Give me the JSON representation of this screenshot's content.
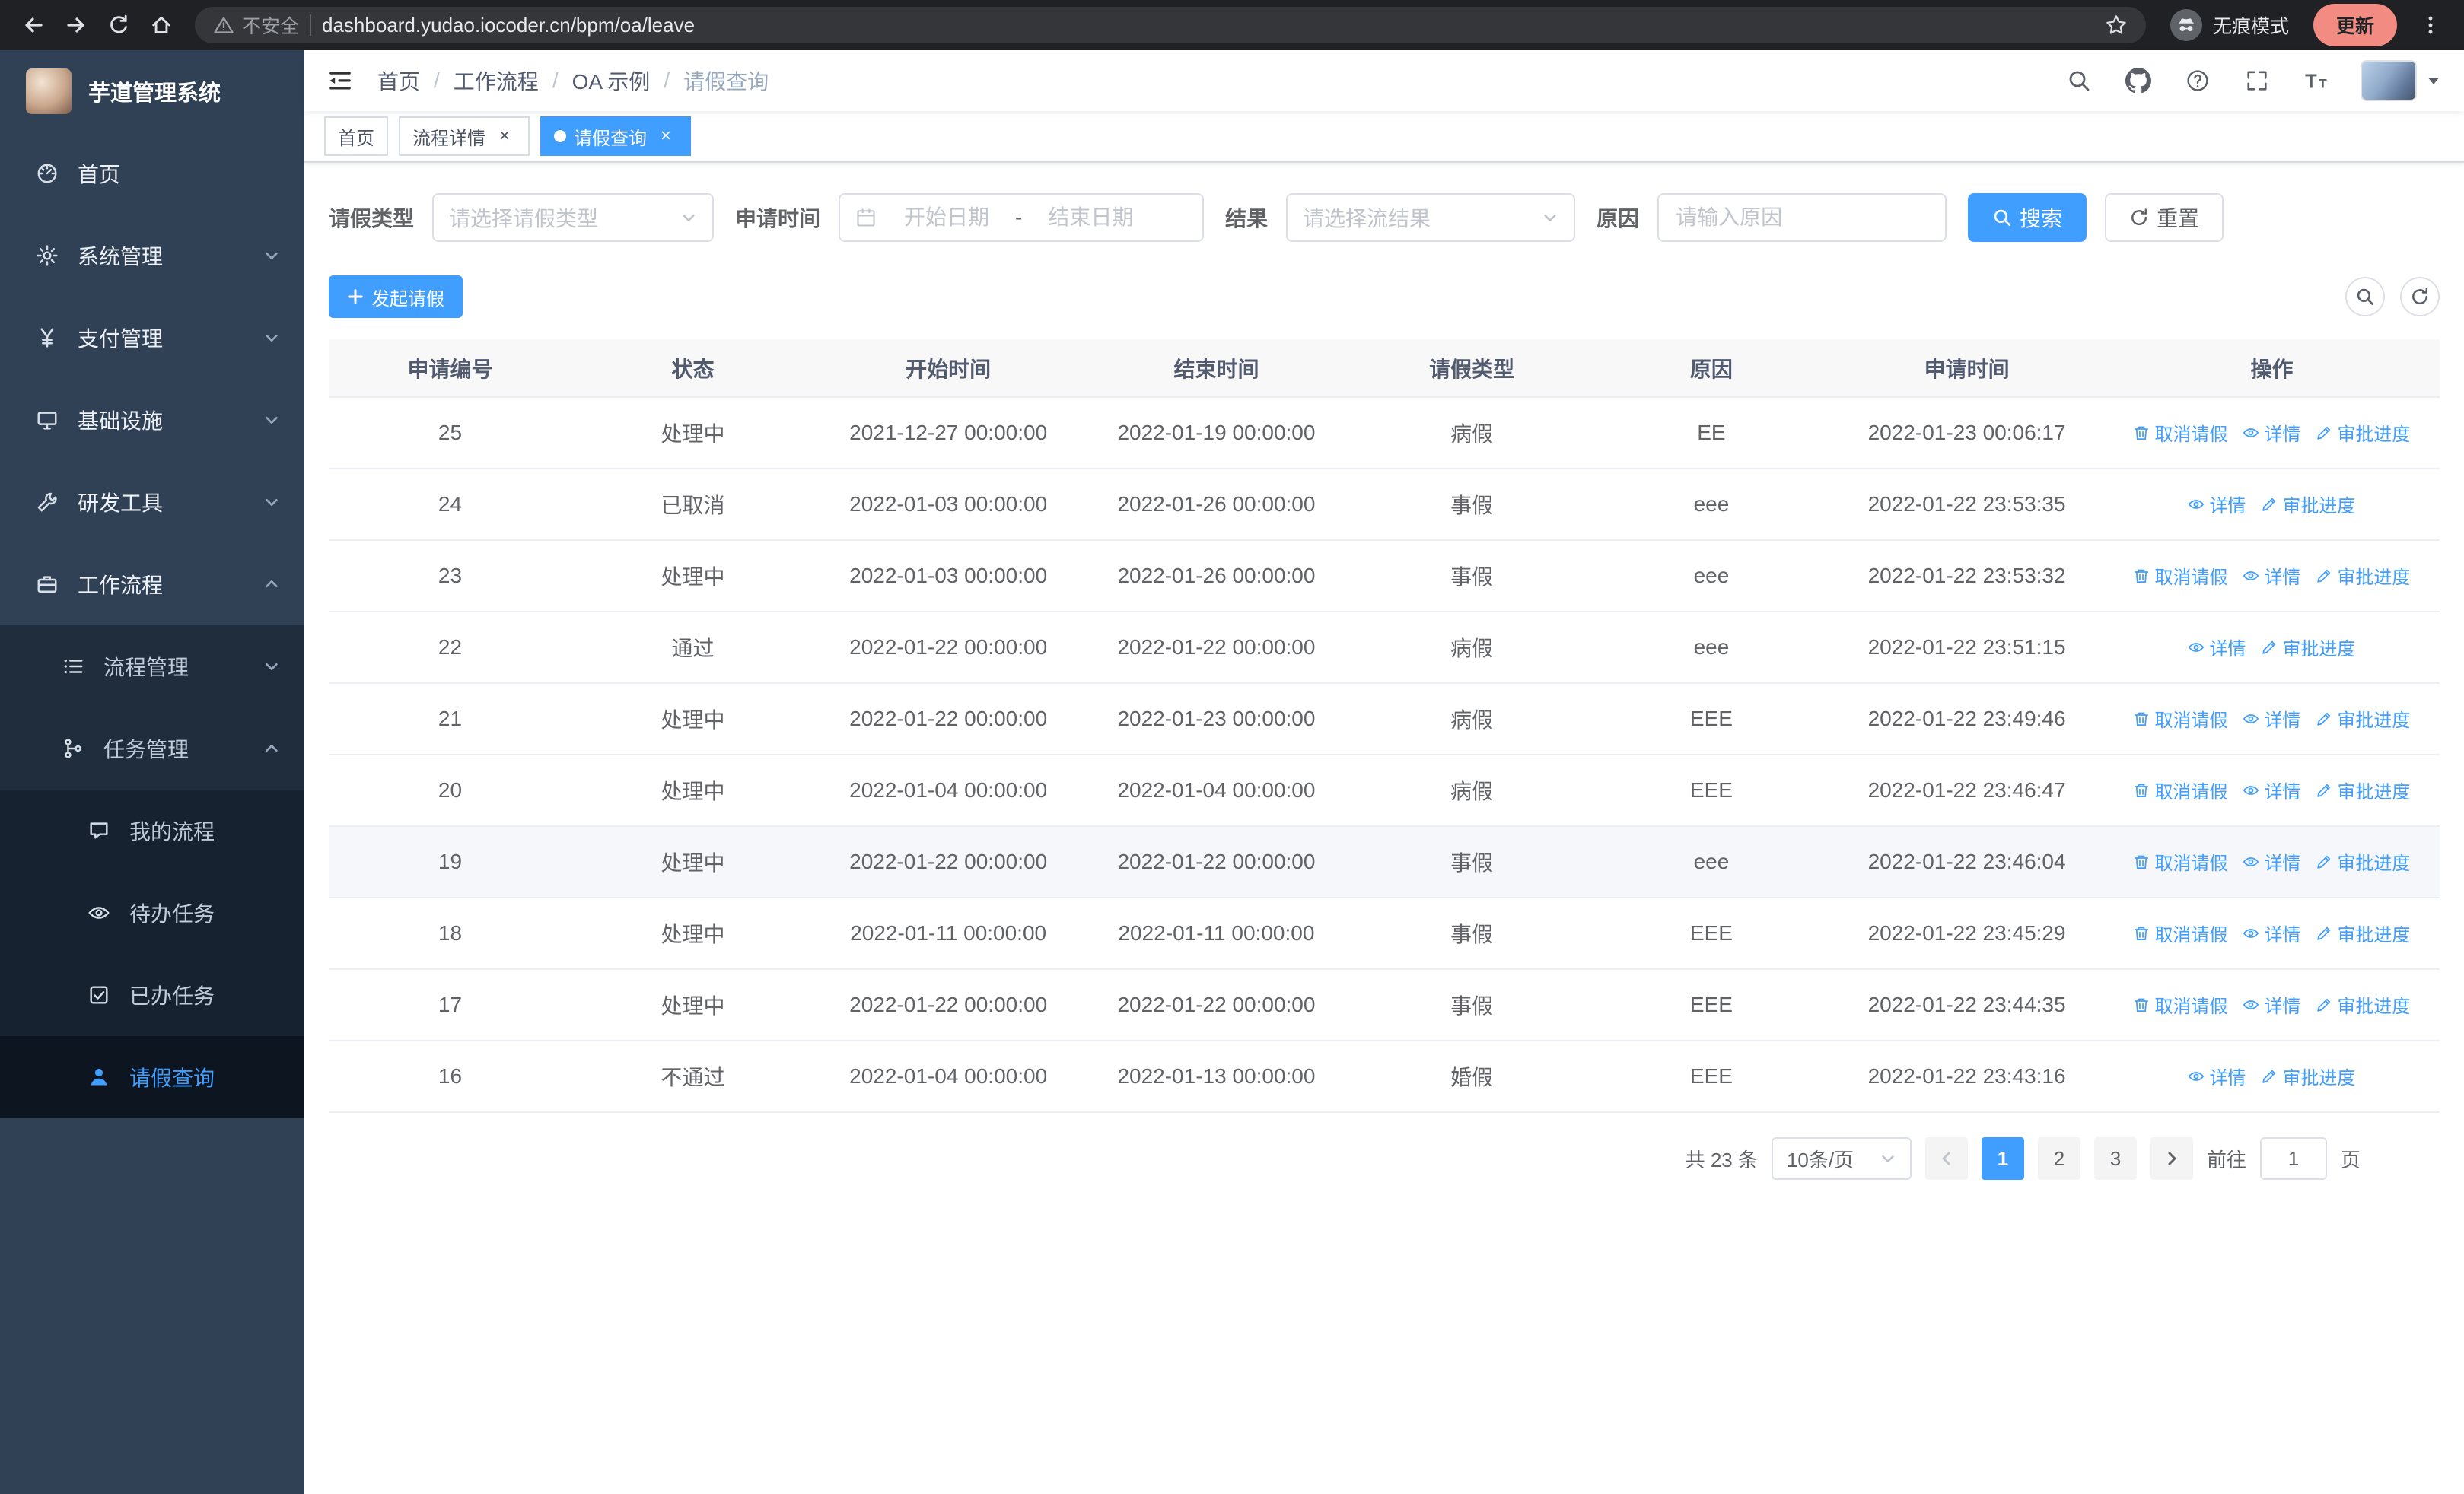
{
  "browser": {
    "security_chip": "不安全",
    "url": "dashboard.yudao.iocoder.cn/bpm/oa/leave",
    "incognito_label": "无痕模式",
    "update_label": "更新"
  },
  "sidebar": {
    "title": "芋道管理系统",
    "items": [
      {
        "label": "首页",
        "icon": "dashboard-icon"
      },
      {
        "label": "系统管理",
        "icon": "gear-icon"
      },
      {
        "label": "支付管理",
        "icon": "yen-icon"
      },
      {
        "label": "基础设施",
        "icon": "monitor-icon"
      },
      {
        "label": "研发工具",
        "icon": "wrench-icon"
      },
      {
        "label": "工作流程",
        "icon": "briefcase-icon"
      }
    ],
    "workflow_menu": [
      {
        "label": "流程管理",
        "icon": "list-icon"
      },
      {
        "label": "任务管理",
        "icon": "branch-icon"
      }
    ],
    "task_menu": [
      {
        "label": "我的流程",
        "icon": "chat-icon"
      },
      {
        "label": "待办任务",
        "icon": "eye-open-icon"
      },
      {
        "label": "已办任务",
        "icon": "check-square-icon"
      },
      {
        "label": "请假查询",
        "icon": "person-icon",
        "active": true
      }
    ]
  },
  "header": {
    "breadcrumb": [
      "首页",
      "工作流程",
      "OA 示例",
      "请假查询"
    ],
    "separator": "/"
  },
  "tags": [
    {
      "label": "首页",
      "closable": false,
      "active": false
    },
    {
      "label": "流程详情",
      "closable": true,
      "active": false
    },
    {
      "label": "请假查询",
      "closable": true,
      "active": true
    }
  ],
  "filters": {
    "leave_type_label": "请假类型",
    "leave_type_placeholder": "请选择请假类型",
    "apply_time_label": "申请时间",
    "start_date_placeholder": "开始日期",
    "range_separator": "-",
    "end_date_placeholder": "结束日期",
    "result_label": "结果",
    "result_placeholder": "请选择流结果",
    "reason_label": "原因",
    "reason_placeholder": "请输入原因",
    "search_button": "搜索",
    "reset_button": "重置"
  },
  "toolbar": {
    "create_button": "发起请假"
  },
  "table": {
    "columns": [
      "申请编号",
      "状态",
      "开始时间",
      "结束时间",
      "请假类型",
      "原因",
      "申请时间",
      "操作"
    ],
    "action_labels": {
      "cancel": "取消请假",
      "detail": "详情",
      "progress": "审批进度"
    },
    "action_icons": {
      "cancel": "trash-icon",
      "detail": "eye-icon",
      "progress": "edit-icon"
    },
    "rows": [
      {
        "id": "25",
        "status": "处理中",
        "start": "2021-12-27 00:00:00",
        "end": "2022-01-19 00:00:00",
        "type": "病假",
        "reason": "EE",
        "apply_time": "2022-01-23 00:06:17",
        "actions": [
          "cancel",
          "detail",
          "progress"
        ]
      },
      {
        "id": "24",
        "status": "已取消",
        "start": "2022-01-03 00:00:00",
        "end": "2022-01-26 00:00:00",
        "type": "事假",
        "reason": "eee",
        "apply_time": "2022-01-22 23:53:35",
        "actions": [
          "detail",
          "progress"
        ]
      },
      {
        "id": "23",
        "status": "处理中",
        "start": "2022-01-03 00:00:00",
        "end": "2022-01-26 00:00:00",
        "type": "事假",
        "reason": "eee",
        "apply_time": "2022-01-22 23:53:32",
        "actions": [
          "cancel",
          "detail",
          "progress"
        ]
      },
      {
        "id": "22",
        "status": "通过",
        "start": "2022-01-22 00:00:00",
        "end": "2022-01-22 00:00:00",
        "type": "病假",
        "reason": "eee",
        "apply_time": "2022-01-22 23:51:15",
        "actions": [
          "detail",
          "progress"
        ]
      },
      {
        "id": "21",
        "status": "处理中",
        "start": "2022-01-22 00:00:00",
        "end": "2022-01-23 00:00:00",
        "type": "病假",
        "reason": "EEE",
        "apply_time": "2022-01-22 23:49:46",
        "actions": [
          "cancel",
          "detail",
          "progress"
        ]
      },
      {
        "id": "20",
        "status": "处理中",
        "start": "2022-01-04 00:00:00",
        "end": "2022-01-04 00:00:00",
        "type": "病假",
        "reason": "EEE",
        "apply_time": "2022-01-22 23:46:47",
        "actions": [
          "cancel",
          "detail",
          "progress"
        ]
      },
      {
        "id": "19",
        "status": "处理中",
        "start": "2022-01-22 00:00:00",
        "end": "2022-01-22 00:00:00",
        "type": "事假",
        "reason": "eee",
        "apply_time": "2022-01-22 23:46:04",
        "actions": [
          "cancel",
          "detail",
          "progress"
        ],
        "highlighted": true
      },
      {
        "id": "18",
        "status": "处理中",
        "start": "2022-01-11 00:00:00",
        "end": "2022-01-11 00:00:00",
        "type": "事假",
        "reason": "EEE",
        "apply_time": "2022-01-22 23:45:29",
        "actions": [
          "cancel",
          "detail",
          "progress"
        ]
      },
      {
        "id": "17",
        "status": "处理中",
        "start": "2022-01-22 00:00:00",
        "end": "2022-01-22 00:00:00",
        "type": "事假",
        "reason": "EEE",
        "apply_time": "2022-01-22 23:44:35",
        "actions": [
          "cancel",
          "detail",
          "progress"
        ]
      },
      {
        "id": "16",
        "status": "不通过",
        "start": "2022-01-04 00:00:00",
        "end": "2022-01-13 00:00:00",
        "type": "婚假",
        "reason": "EEE",
        "apply_time": "2022-01-22 23:43:16",
        "actions": [
          "detail",
          "progress"
        ]
      }
    ]
  },
  "pagination": {
    "total_text": "共 23 条",
    "page_size": "10条/页",
    "pages": [
      "1",
      "2",
      "3"
    ],
    "current_page": "1",
    "goto_label": "前往",
    "goto_value": "1",
    "page_unit": "页"
  },
  "colors": {
    "primary": "#409eff",
    "sidebar_bg": "#304156",
    "sidebar_submenu_bg": "#1f2d3d",
    "browser_bar_bg": "#202124"
  }
}
